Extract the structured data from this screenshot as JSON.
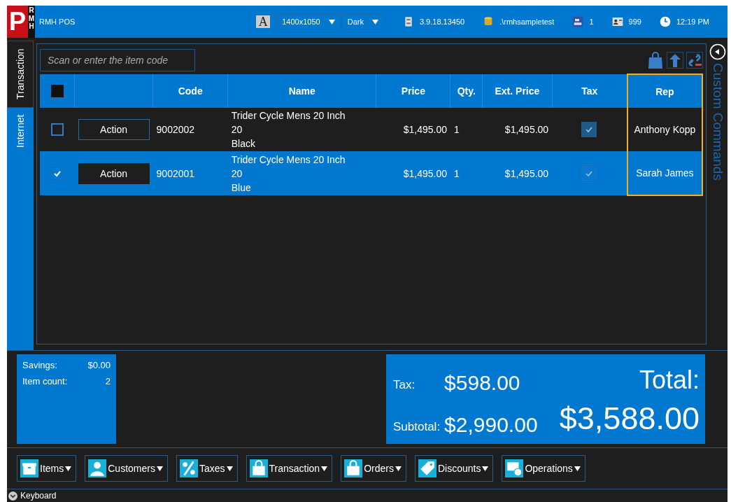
{
  "header": {
    "logo_letter": "P",
    "logo_sub": "RMH",
    "app_name": "RMH POS",
    "font_letter": "A",
    "resolution": "1400x1050",
    "theme": "Dark",
    "version": "3.9.18.13450",
    "database": ".\\rmhsampletest",
    "register": "1",
    "cashier": "999",
    "time": "12:19 PM"
  },
  "tabs": [
    {
      "label": "Transaction",
      "selected": true
    },
    {
      "label": "Internet",
      "selected": false
    }
  ],
  "search": {
    "placeholder": "Scan or enter the item code"
  },
  "table": {
    "header_checkbox": {
      "checked": false
    },
    "columns": [
      {
        "label": "Code",
        "highlighted": false
      },
      {
        "label": "Name",
        "highlighted": false
      },
      {
        "label": "Price",
        "highlighted": false
      },
      {
        "label": "Qty.",
        "highlighted": false
      },
      {
        "label": "Ext. Price",
        "highlighted": false
      },
      {
        "label": "Tax",
        "highlighted": false
      },
      {
        "label": "Rep",
        "highlighted": true
      }
    ],
    "rows": [
      {
        "checked": false,
        "selected": false,
        "action": "Action",
        "code": "9002002",
        "name_lines": [
          "Trider Cycle Mens 20 Inch",
          "20",
          "Black"
        ],
        "price": "$1,495.00",
        "qty": "1",
        "ext_price": "$1,495.00",
        "taxable": true,
        "rep": "Anthony Kopp"
      },
      {
        "checked": true,
        "selected": true,
        "action": "Action",
        "code": "9002001",
        "name_lines": [
          "Trider Cycle Mens 20 Inch",
          "20",
          "Blue"
        ],
        "price": "$1,495.00",
        "qty": "1",
        "ext_price": "$1,495.00",
        "taxable": true,
        "rep": "Sarah James"
      }
    ]
  },
  "side_panel": {
    "label": "Custom Commands"
  },
  "summary": {
    "savings_label": "Savings:",
    "savings": "$0.00",
    "item_count_label": "Item count:",
    "item_count": "2"
  },
  "totals": {
    "tax_label": "Tax:",
    "tax": "$598.00",
    "subtotal_label": "Subtotal:",
    "subtotal": "$2,990.00",
    "total_label": "Total:",
    "total": "$3,588.00"
  },
  "toolbar": [
    {
      "label": "Items",
      "kind": "box"
    },
    {
      "label": "Customers",
      "kind": "person"
    },
    {
      "label": "Taxes",
      "kind": "percent"
    },
    {
      "label": "Transaction",
      "kind": "bag"
    },
    {
      "label": "Orders",
      "kind": "bag"
    },
    {
      "label": "Discounts",
      "kind": "tag"
    },
    {
      "label": "Operations",
      "kind": "screen"
    }
  ],
  "footer": {
    "label": "Keyboard"
  }
}
